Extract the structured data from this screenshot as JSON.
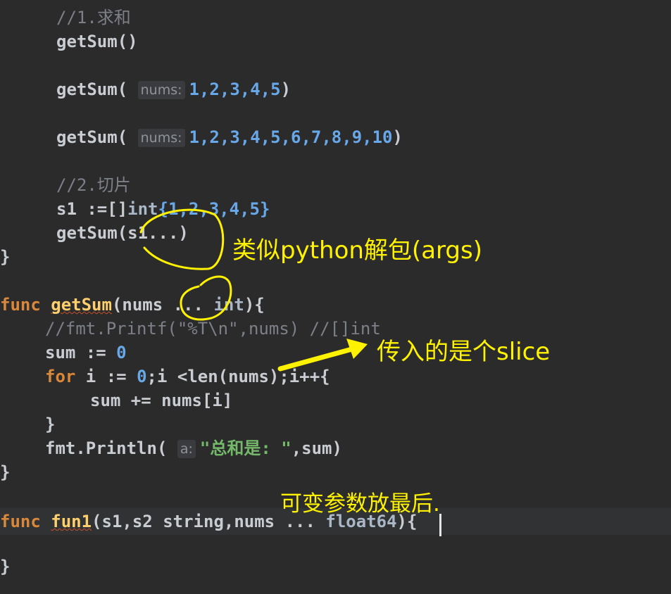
{
  "code": {
    "cmt_sum": "//1.求和",
    "call_empty": "getSum()",
    "call_a_open": "getSum(",
    "hint_nums_a": "nums:",
    "args_a": "1,2,3,4,5",
    "call_a_close": ")",
    "call_b_open": "getSum(",
    "hint_nums_b": "nums:",
    "args_b": "1,2,3,4,5,6,7,8,9,10",
    "call_b_close": ")",
    "cmt_slice": "//2.切片",
    "s1_decl_a": "s1 :=[]",
    "s1_decl_type": "int",
    "s1_decl_b": "{1,2,3,4,5}",
    "call_unpack": "getSum(s1...)",
    "close_brace_1": "}",
    "kw_func_1": "func",
    "fn_getsum": "getSum",
    "params_getsum_a": "(nums ...",
    "params_getsum_type": "int",
    "params_getsum_b": "){",
    "cmt_printf": "//fmt.Printf(\"%T\\n\",nums) //[]int",
    "sum_decl_a": "sum := ",
    "sum_decl_zero": "0",
    "kw_for": "for",
    "for_a": " i := ",
    "for_zero": "0",
    "for_b": ";i <len(nums);i++{",
    "sum_add": "sum += nums[i]",
    "close_brace_for": "}",
    "println_open": "fmt.Println(",
    "hint_a": "a:",
    "println_str": "\"总和是: \"",
    "println_close": ",sum)",
    "close_brace_2": "}",
    "kw_func_2": "func",
    "fn_fun1": "fun1",
    "params_fun1": "(s1,s2 string,nums ... ",
    "params_fun1_type": "float64",
    "params_fun1_end": "){",
    "close_brace_3": "}"
  },
  "annotations": {
    "unpack_note": "类似python解包(args)",
    "slice_note": "传入的是个slice",
    "last_note": "可变参数放最后."
  },
  "colors": {
    "background": "#2b2b2c",
    "annotation": "#fff200",
    "keyword": "#d9873a",
    "function": "#ffcf6d",
    "number": "#68a8e8",
    "string": "#74b96a"
  }
}
